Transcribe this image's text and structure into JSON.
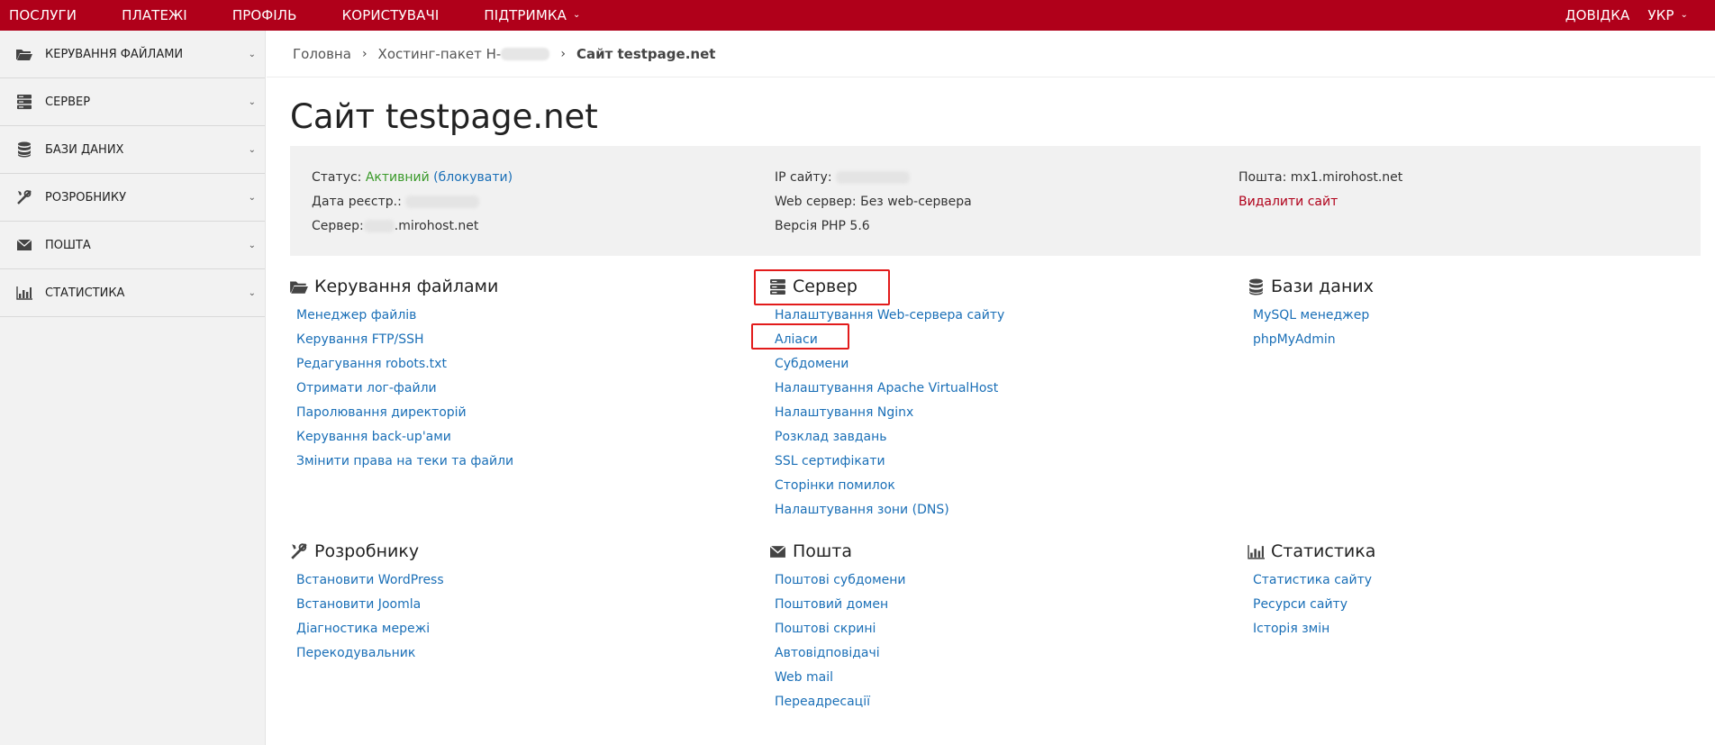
{
  "topbar": {
    "nav": [
      "ПОСЛУГИ",
      "ПЛАТЕЖІ",
      "ПРОФІЛЬ",
      "КОРИСТУВАЧІ",
      "ПІДТРИМКА"
    ],
    "help": "ДОВІДКА",
    "lang": "УКР",
    "bg_color": "#b0001a"
  },
  "sidebar": {
    "items": [
      {
        "label": "Керування файлами",
        "icon": "folder-open-icon"
      },
      {
        "label": "Сервер",
        "icon": "server-icon"
      },
      {
        "label": "Бази даних",
        "icon": "database-icon"
      },
      {
        "label": "Розробнику",
        "icon": "tools-icon"
      },
      {
        "label": "Пошта",
        "icon": "envelope-icon"
      },
      {
        "label": "Статистика",
        "icon": "bar-chart-icon"
      }
    ]
  },
  "breadcrumb": {
    "home": "Головна",
    "package": "Хостинг-пакет Н-",
    "current": "Сайт testpage.net"
  },
  "page": {
    "title": "Сайт testpage.net"
  },
  "info": {
    "status_label": "Статус:",
    "status_value": "Активний",
    "status_action": "(блокувати)",
    "reg_date_label": "Дата реєстр.:",
    "server_label": "Сервер:",
    "server_suffix": ".mirohost.net",
    "ip_label": "IP сайту:",
    "webserver": "Web сервер: Без web-сервера",
    "php": "Версія PHP 5.6",
    "mail": "Пошта: mx1.mirohost.net",
    "delete": "Видалити сайт"
  },
  "sections": {
    "files": {
      "title": "Керування файлами",
      "links": [
        "Менеджер файлів",
        "Керування FTP/SSH",
        "Редагування robots.txt",
        "Отримати лог-файли",
        "Паролювання директорій",
        "Керування back-up'ами",
        "Змінити права на теки та файли"
      ]
    },
    "server": {
      "title": "Сервер",
      "links": [
        "Налаштування Web-сервера сайту",
        "Аліаси",
        "Субдомени",
        "Налаштування Apache VirtualHost",
        "Налаштування Nginx",
        "Розклад завдань",
        "SSL сертифікати",
        "Сторінки помилок",
        "Налаштування зони (DNS)"
      ]
    },
    "db": {
      "title": "Бази даних",
      "links": [
        "MySQL менеджер",
        "phpMyAdmin"
      ]
    },
    "dev": {
      "title": "Розробнику",
      "links": [
        "Встановити WordPress",
        "Встановити Joomla",
        "Діагностика мережі",
        "Перекодувальник"
      ]
    },
    "mail": {
      "title": "Пошта",
      "links": [
        "Поштові субдомени",
        "Поштовий домен",
        "Поштові скрині",
        "Автовідповідачі",
        "Web mail",
        "Переадресації"
      ]
    },
    "stats": {
      "title": "Статистика",
      "links": [
        "Статистика сайту",
        "Ресурси сайту",
        "Історія змін"
      ]
    }
  }
}
